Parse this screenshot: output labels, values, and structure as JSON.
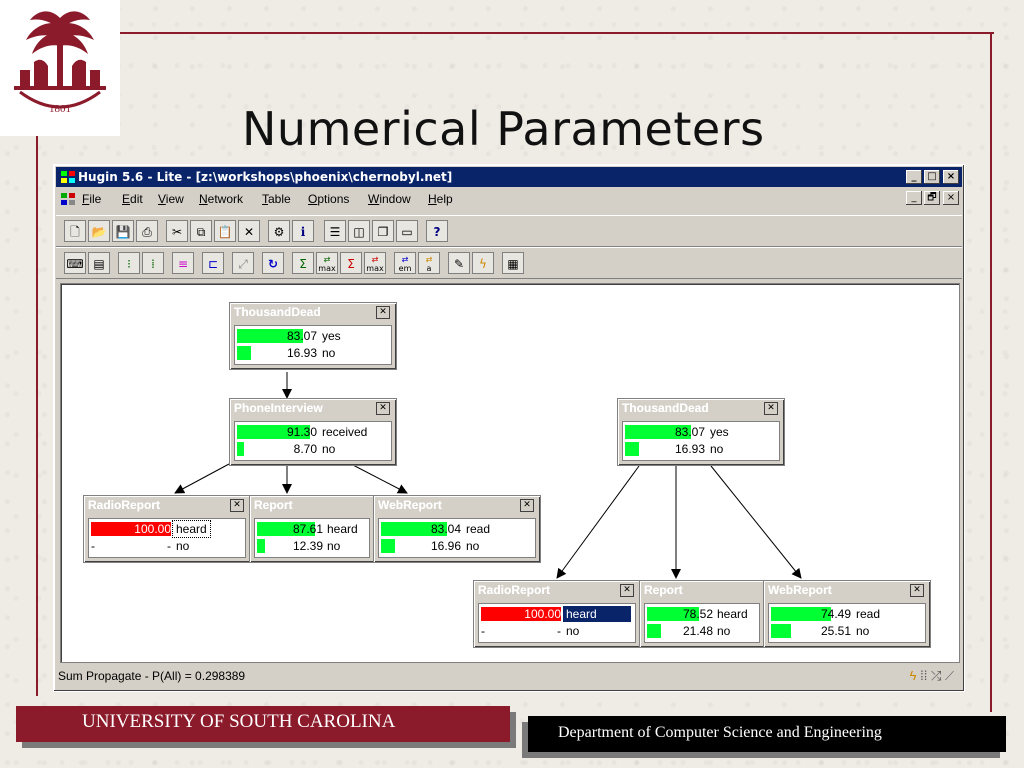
{
  "slide": {
    "title": "Numerical Parameters",
    "logo_year": "1801",
    "footer_left": "UNIVERSITY OF SOUTH CAROLINA",
    "footer_right": "Department of Computer Science and Engineering",
    "colors": {
      "garnet": "#8b1a2b",
      "titlebar": "#0a246a",
      "bar_green": "#00ff33",
      "bar_red": "#ff0000"
    }
  },
  "window": {
    "title": "Hugin 5.6 - Lite - [z:\\workshops\\phoenix\\chernobyl.net]",
    "buttons": {
      "minimize": "_",
      "maximize": "□",
      "close": "×",
      "restore": "🗗"
    },
    "menu": [
      {
        "pre": "",
        "key": "F",
        "post": "ile"
      },
      {
        "pre": "",
        "key": "E",
        "post": "dit"
      },
      {
        "pre": "",
        "key": "V",
        "post": "iew"
      },
      {
        "pre": "",
        "key": "N",
        "post": "etwork"
      },
      {
        "pre": "",
        "key": "T",
        "post": "able"
      },
      {
        "pre": "",
        "key": "O",
        "post": "ptions"
      },
      {
        "pre": "",
        "key": "W",
        "post": "indow"
      },
      {
        "pre": "",
        "key": "H",
        "post": "elp"
      }
    ],
    "toolbar2_text": {
      "max1": "max",
      "max2": "max",
      "em": "em",
      "a": "a",
      "help": "?",
      "info": "i"
    },
    "status": "Sum Propagate - P(All) = 0.298389"
  },
  "network": {
    "nodes": [
      {
        "id": "td1",
        "title": "ThousandDead",
        "states": [
          {
            "value": "83.07",
            "label": "yes",
            "fill": 0.8307,
            "color": "#00ff33"
          },
          {
            "value": "16.93",
            "label": "no",
            "fill": 0.1693,
            "color": "#00ff33"
          }
        ]
      },
      {
        "id": "pi",
        "title": "PhoneInterview",
        "states": [
          {
            "value": "91.30",
            "label": "received",
            "fill": 0.913,
            "color": "#00ff33"
          },
          {
            "value": "8.70",
            "label": "no",
            "fill": 0.087,
            "color": "#00ff33"
          }
        ]
      },
      {
        "id": "rr1",
        "title": "RadioReport",
        "states": [
          {
            "value": "100.00",
            "label": "heard",
            "fill": 1.0,
            "color": "#ff0000"
          },
          {
            "value": "-",
            "label": "no",
            "fill": 0,
            "color": "#00ff33"
          }
        ]
      },
      {
        "id": "rep1",
        "title": "Report",
        "states": [
          {
            "value": "87.61",
            "label": "heard",
            "fill": 0.8761,
            "color": "#00ff33"
          },
          {
            "value": "12.39",
            "label": "no",
            "fill": 0.1239,
            "color": "#00ff33"
          }
        ]
      },
      {
        "id": "wr1",
        "title": "WebReport",
        "states": [
          {
            "value": "83.04",
            "label": "read",
            "fill": 0.8304,
            "color": "#00ff33"
          },
          {
            "value": "16.96",
            "label": "no",
            "fill": 0.1696,
            "color": "#00ff33"
          }
        ]
      },
      {
        "id": "td2",
        "title": "ThousandDead",
        "states": [
          {
            "value": "83.07",
            "label": "yes",
            "fill": 0.8307,
            "color": "#00ff33"
          },
          {
            "value": "16.93",
            "label": "no",
            "fill": 0.1693,
            "color": "#00ff33"
          }
        ]
      },
      {
        "id": "rr2",
        "title": "RadioReport",
        "states": [
          {
            "value": "100.00",
            "label": "heard",
            "fill": 1.0,
            "color": "#ff0000"
          },
          {
            "value": "-",
            "label": "no",
            "fill": 0,
            "color": "#00ff33"
          }
        ]
      },
      {
        "id": "rep2",
        "title": "Report",
        "states": [
          {
            "value": "78.52",
            "label": "heard",
            "fill": 0.7852,
            "color": "#00ff33"
          },
          {
            "value": "21.48",
            "label": "no",
            "fill": 0.2148,
            "color": "#00ff33"
          }
        ]
      },
      {
        "id": "wr2",
        "title": "WebReport",
        "states": [
          {
            "value": "74.49",
            "label": "read",
            "fill": 0.7449,
            "color": "#00ff33"
          },
          {
            "value": "25.51",
            "label": "no",
            "fill": 0.2551,
            "color": "#00ff33"
          }
        ]
      }
    ]
  }
}
